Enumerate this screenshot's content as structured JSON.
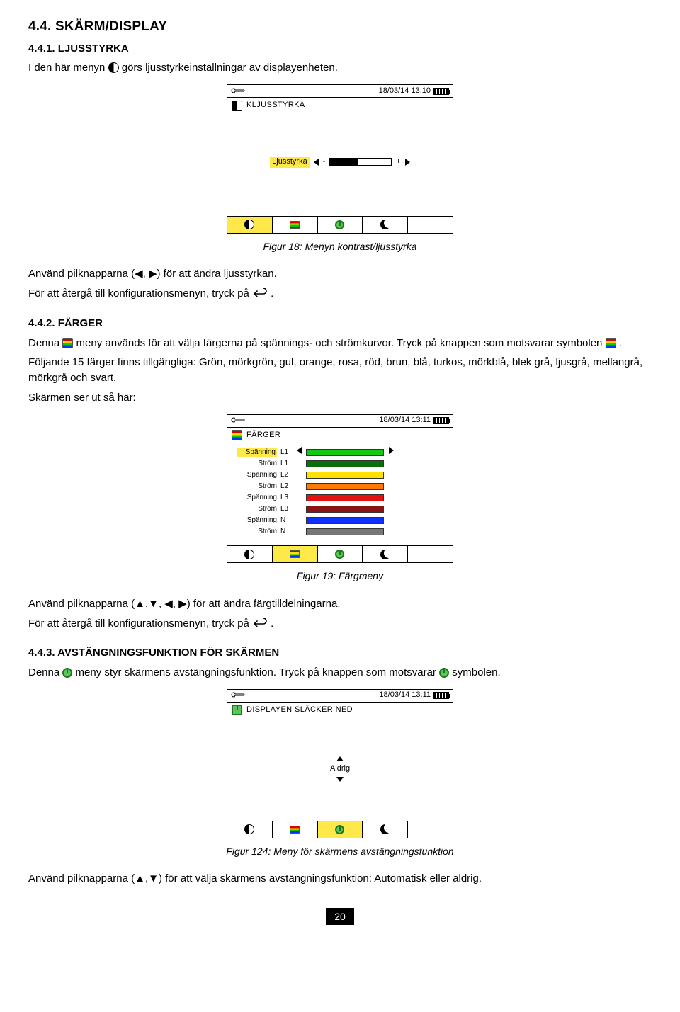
{
  "headings": {
    "h44": "4.4. SKÄRM/DISPLAY",
    "h441": "4.4.1. LJUSSTYRKA",
    "h442": "4.4.2. FÄRGER",
    "h443": "4.4.3. AVSTÄNGNINGSFUNKTION FÖR SKÄRMEN"
  },
  "text": {
    "intro441a": "I den här menyn ",
    "intro441b": " görs ljusstyrkeinställningar av displayenheten.",
    "use_arrows_lr": "Använd pilknapparna (◀, ▶) för att ändra ljusstyrkan.",
    "back_to_config_a": "För att återgå till konfigurationsmenyn, tryck på ",
    "back_to_config_b": ".",
    "p442_a": "Denna ",
    "p442_b": " meny används för att välja färgerna på spännings- och strömkurvor. Tryck på knappen som motsvarar symbolen ",
    "p442_c": ".",
    "p442_colors": "Följande 15 färger finns tillgängliga: Grön, mörkgrön, gul, orange, rosa, röd, brun, blå, turkos, mörkblå, blek grå, ljusgrå, mellangrå, mörkgrå och svart.",
    "screen_looks": "Skärmen ser ut så här:",
    "use_arrows_all": "Använd pilknapparna (▲,▼, ◀, ▶) för att ändra färgtilldelningarna.",
    "p443_a": "Denna ",
    "p443_b": " meny styr skärmens avstängningsfunktion. Tryck på knappen som motsvarar ",
    "p443_c": " symbolen.",
    "use_arrows_ud": "Använd pilknapparna (▲,▼) för att välja skärmens avstängningsfunktion: Automatisk eller aldrig."
  },
  "captions": {
    "fig18": "Figur 18: Menyn kontrast/ljusstyrka",
    "fig19": "Figur 19: Färgmeny",
    "fig124": "Figur 124: Meny för skärmens avstängningsfunktion"
  },
  "device18": {
    "datetime": "18/03/14  13:10",
    "title": "KLJUSSTYRKA",
    "slider_label": "Ljusstyrka"
  },
  "device19": {
    "datetime": "18/03/14  13:11",
    "title": "FÄRGER",
    "rows": [
      {
        "name": "Spänning",
        "ch": "L1",
        "color": "#14c914",
        "hl": true,
        "arrows": true
      },
      {
        "name": "Ström",
        "ch": "L1",
        "color": "#0a6e0a"
      },
      {
        "name": "Spänning",
        "ch": "L2",
        "color": "#ffe100"
      },
      {
        "name": "Ström",
        "ch": "L2",
        "color": "#ff7a00"
      },
      {
        "name": "Spänning",
        "ch": "L3",
        "color": "#e21212"
      },
      {
        "name": "Ström",
        "ch": "L3",
        "color": "#8a1313"
      },
      {
        "name": "Spänning",
        "ch": "N",
        "color": "#1030ff"
      },
      {
        "name": "Ström",
        "ch": "N",
        "color": "#777777"
      }
    ]
  },
  "device124": {
    "datetime": "18/03/14  13:11",
    "title": "DISPLAYEN SLÄCKER NED",
    "value": "Aldrig"
  },
  "page_number": "20"
}
